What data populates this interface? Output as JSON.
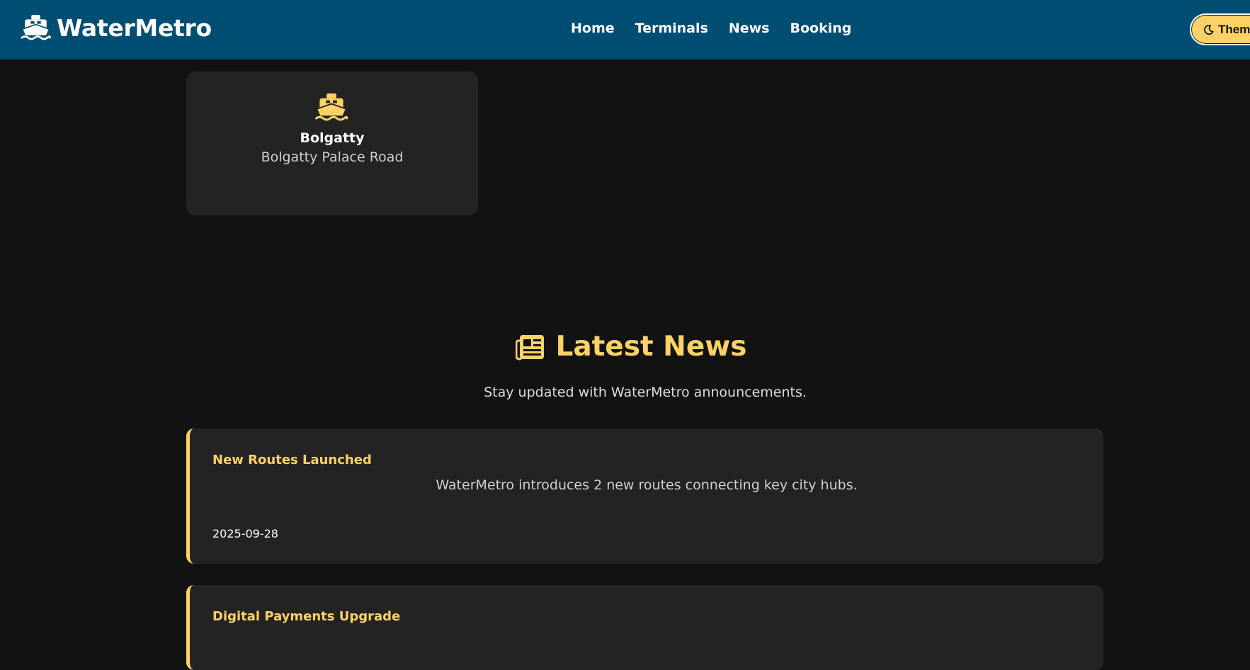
{
  "header": {
    "brand": "WaterMetro",
    "nav": [
      "Home",
      "Terminals",
      "News",
      "Booking"
    ],
    "theme_label": "Theme"
  },
  "terminal": {
    "name": "Bolgatty",
    "address": "Bolgatty Palace Road"
  },
  "news": {
    "title": "Latest News",
    "subtitle": "Stay updated with WaterMetro announcements.",
    "items": [
      {
        "title": "New Routes Launched",
        "body": "WaterMetro introduces 2 new routes connecting key city hubs.",
        "date": "2025-09-28"
      },
      {
        "title": "Digital Payments Upgrade"
      }
    ]
  },
  "colors": {
    "header_bg": "#004d73",
    "accent": "#ffd166",
    "page_bg": "#121212",
    "card_bg": "#232323"
  },
  "icons": {
    "brand": "ship-icon",
    "terminal": "ship-icon",
    "news": "newspaper-icon",
    "theme": "moon-icon"
  }
}
